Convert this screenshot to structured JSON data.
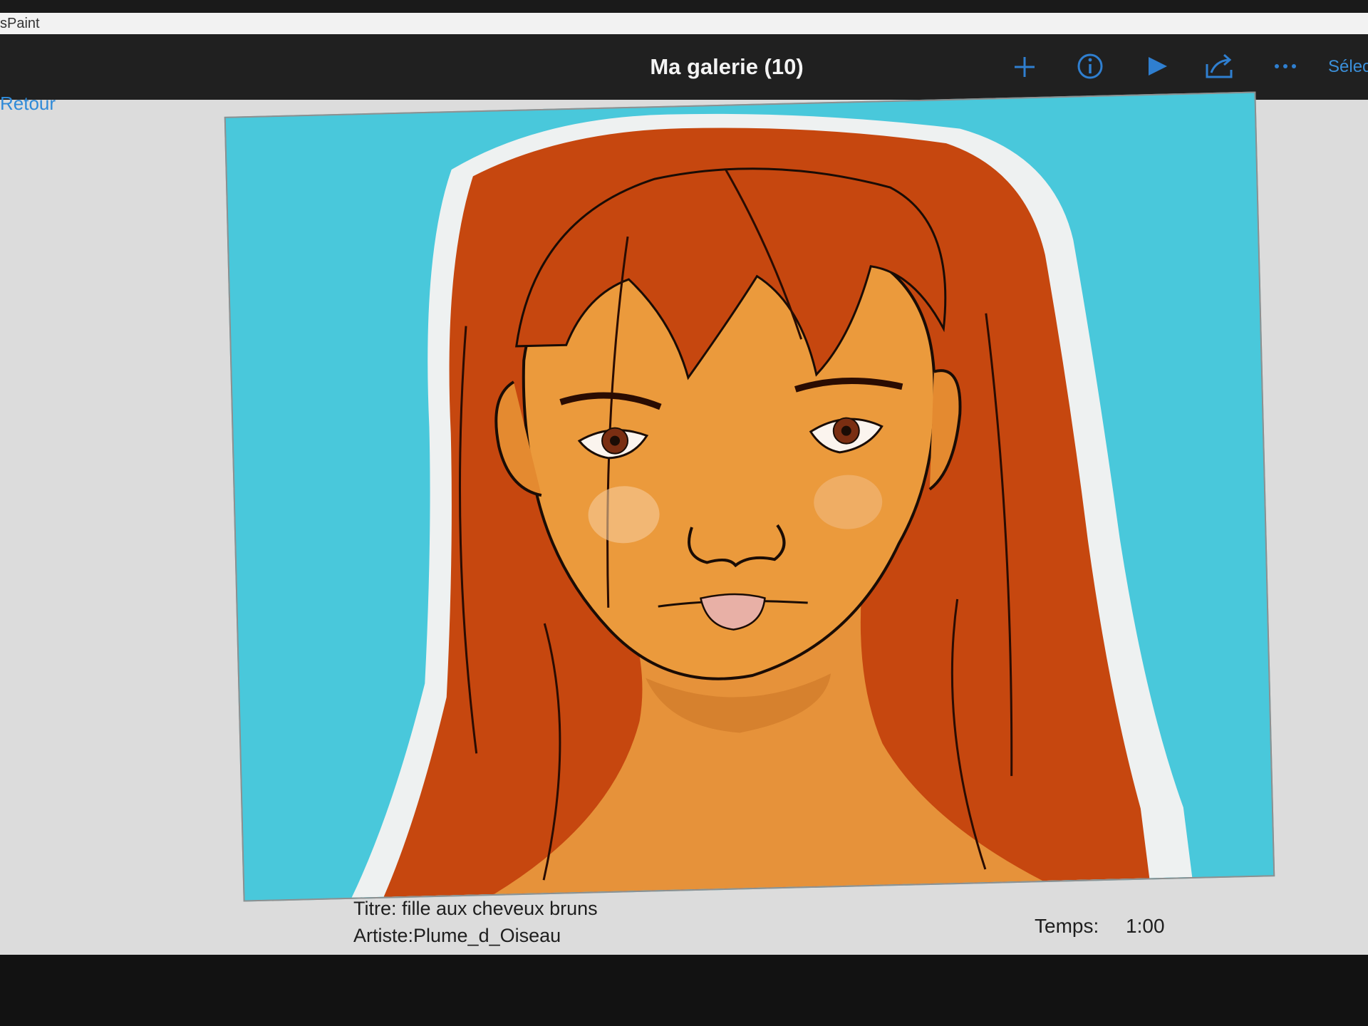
{
  "window": {
    "app_name": "sPaint"
  },
  "command_bar": {
    "gallery_title": "Ma galerie (10)",
    "select_label": "Sélec",
    "icons": [
      "plus-icon",
      "info-icon",
      "play-icon",
      "share-icon",
      "more-icon"
    ],
    "accent_color": "#2f8ad8"
  },
  "navigation": {
    "back_label": "Retour"
  },
  "artwork": {
    "background_color": "#49c8db",
    "hair_color": "#c6470f",
    "skin_color": "#eb9a3c"
  },
  "details": {
    "title": "Titre: fille aux cheveux bruns",
    "artist": "Artiste:Plume_d_Oiseau",
    "time_label": "Temps:",
    "time_value": "1:00"
  }
}
